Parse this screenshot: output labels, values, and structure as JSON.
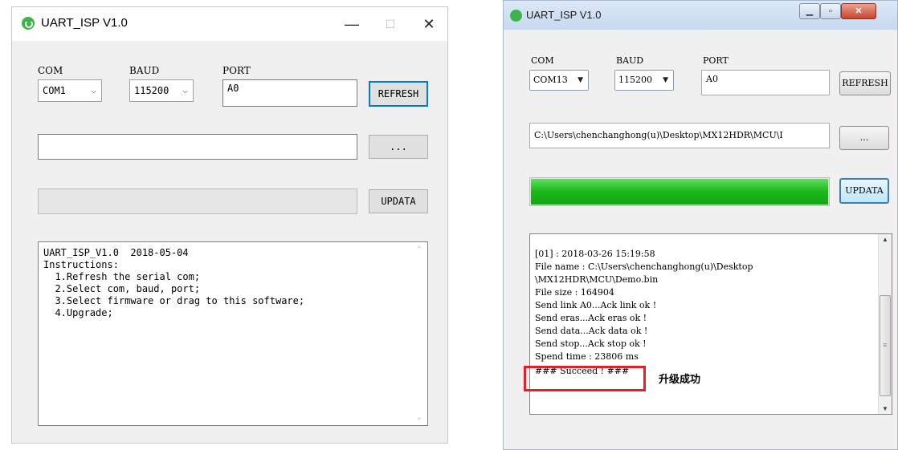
{
  "window1": {
    "title": "UART_ISP V1.0",
    "controls": {
      "minimize": "—",
      "maximize": "☐",
      "close": "✕"
    },
    "labels": {
      "com": "COM",
      "baud": "BAUD",
      "port": "PORT"
    },
    "com_value": "COM1",
    "baud_value": "115200",
    "port_value": "A0",
    "refresh_button": "REFRESH",
    "file_path": "",
    "browse_button": "...",
    "update_button": "UPDATA",
    "progress": 0,
    "log_lines": [
      "UART_ISP_V1.0  2018-05-04",
      "Instructions:",
      "  1.Refresh the serial com;",
      "  2.Select com, baud, port;",
      "  3.Select firmware or drag to this software;",
      "  4.Upgrade;"
    ]
  },
  "window2": {
    "title": "UART_ISP V1.0",
    "labels": {
      "com": "COM",
      "baud": "BAUD",
      "port": "PORT"
    },
    "com_value": "COM13",
    "baud_value": "115200",
    "port_value": "A0",
    "refresh_button": "REFRESH",
    "file_path": "C:\\Users\\chenchanghong(u)\\Desktop\\MX12HDR\\MCU\\I",
    "browse_button": "...",
    "update_button": "UPDATA",
    "progress": 1.0,
    "progress_color": "#1ab81a",
    "log_lines": [
      "[01] : 2018-03-26 15:19:58",
      "File name : C:\\Users\\chenchanghong(u)\\Desktop",
      "\\MX12HDR\\MCU\\Demo.bin",
      "File size : 164904",
      "Send link A0...Ack link ok !",
      "Send eras...Ack eras ok !",
      "Send data...Ack data ok !",
      "Send stop...Ack stop ok !",
      "Spend time : 23806 ms",
      "### Succeed ! ###"
    ],
    "annotation": "升级成功",
    "highlight_color": "#e0212a"
  }
}
